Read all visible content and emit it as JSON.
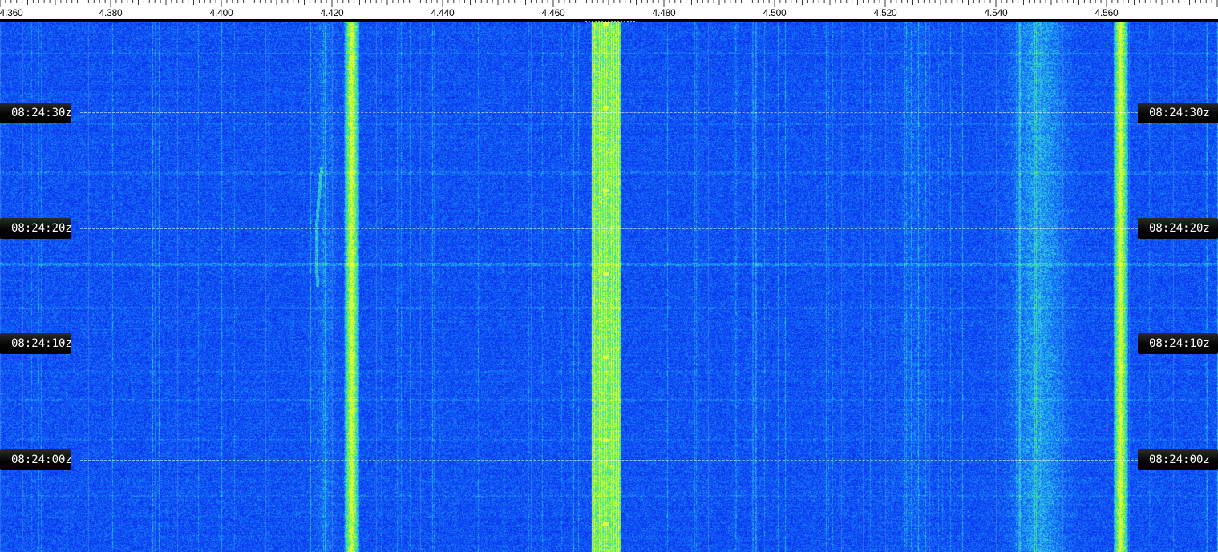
{
  "frequency_axis": {
    "ticks": [
      "4.360",
      "4.380",
      "4.400",
      "4.420",
      "4.440",
      "4.460",
      "4.480",
      "4.500",
      "4.520",
      "4.540",
      "4.560"
    ]
  },
  "waterfall": {
    "time_markers": [
      "08:24:30z",
      "08:24:20z",
      "08:24:10z",
      "08:24:00z"
    ],
    "colors": {
      "background": "#0a33f0",
      "signal_strong": "#66ff33",
      "signal_medium": "#33ccff",
      "noise_low": "#0018c0"
    },
    "signals": [
      {
        "freq": 4.4235,
        "strength": "strong",
        "type": "carrier"
      },
      {
        "freq": 4.4695,
        "strength": "strong",
        "type": "data-burst"
      },
      {
        "freq": 4.5625,
        "strength": "strong",
        "type": "carrier"
      },
      {
        "freq": 4.5415,
        "strength": "medium",
        "type": "broad-noise"
      }
    ]
  }
}
